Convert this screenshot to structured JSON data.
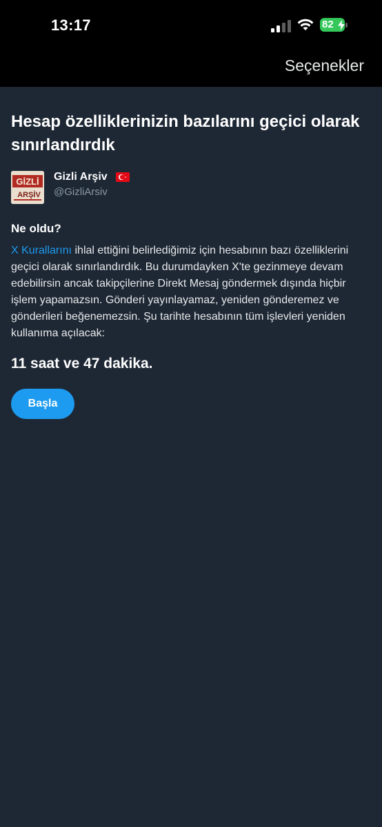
{
  "status_bar": {
    "time": "13:17",
    "battery": "82",
    "icons": [
      "signal-icon",
      "wifi-icon",
      "battery-icon"
    ],
    "battery_color": "#34c759"
  },
  "nav": {
    "options_label": "Seçenekler"
  },
  "main": {
    "title": "Hesap özelliklerinizin bazılarını geçici olarak sınırlandırdık",
    "account": {
      "avatar_text_line1": "GİZLİ",
      "avatar_text_line2": "ARŞİV",
      "name": "Gizli Arşiv",
      "handle": "@GizliArsiv",
      "flag_icon": "turkey-flag-icon"
    },
    "section_title": "Ne oldu?",
    "rules_link": "X Kurallarını",
    "body": "ihlal ettiğini belirlediğimiz için hesabının bazı özelliklerini geçici olarak sınırlandırdık. Bu durumdayken X'te gezinmeye devam edebilirsin ancak takipçilerine Direkt Mesaj göndermek dışında hiçbir işlem yapamazsın. Gönderi yayınlayamaz, yeniden gönderemez ve gönderileri beğenemezsin. Şu tarihte hesabının tüm işlevleri yeniden kullanıma açılacak:",
    "countdown": "11 saat ve 47 dakika.",
    "start_button": "Başla"
  },
  "colors": {
    "background": "#1e2835",
    "link": "#1d9bf0",
    "button": "#1d9bf0"
  }
}
